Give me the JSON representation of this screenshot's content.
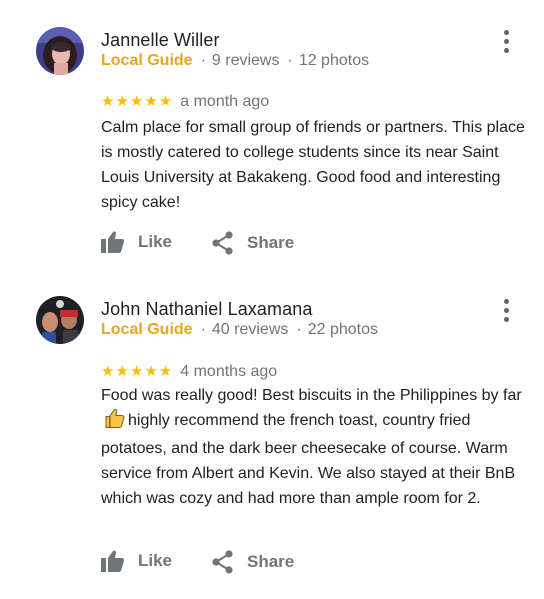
{
  "reviews": [
    {
      "name": "Jannelle Willer",
      "badge": "Local Guide",
      "reviews_count": "9 reviews",
      "photos_count": "12 photos",
      "stars": "★★★★★",
      "rating": 5,
      "time": "a month ago",
      "text_parts": [
        "Calm place for small group of friends or partners. This place is mostly catered to college students since its near Saint Louis University at Bakakeng. Good food and interesting spicy cake!"
      ],
      "like_label": "Like",
      "share_label": "Share"
    },
    {
      "name": "John Nathaniel Laxamana",
      "badge": "Local Guide",
      "reviews_count": "40 reviews",
      "photos_count": "22 photos",
      "stars": "★★★★★",
      "rating": 5,
      "time": "4 months ago",
      "text_parts": [
        "Food was really good! Best biscuits in the Philippines by far",
        "highly recommend the french toast, country fried potatoes, and the dark beer cheesecake of course. Warm service from Albert and Kevin. We also stayed at their BnB which was cozy and had more than ample room for 2."
      ],
      "like_label": "Like",
      "share_label": "Share"
    }
  ],
  "colors": {
    "local_guide": "#e8a61f",
    "stars": "#fbbc04",
    "secondary_text": "#70757a",
    "primary_text": "#202124"
  },
  "icons": [
    "more-vert-icon",
    "thumbs-up-icon",
    "share-icon",
    "thumbs-up-emoji-icon"
  ]
}
